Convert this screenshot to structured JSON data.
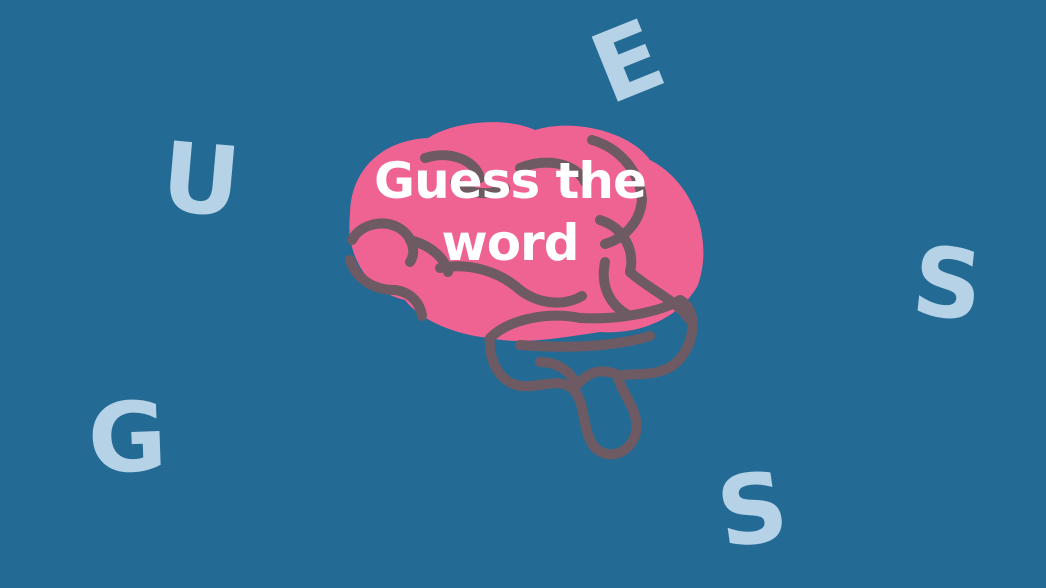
{
  "scene": {
    "title_line1": "Guess the",
    "title_line2": "word",
    "letters": [
      "G",
      "U",
      "E",
      "S",
      "S"
    ]
  },
  "colors": {
    "background": "#236b94",
    "letters": "#b5d2e6",
    "brain_fill": "#ef6392",
    "brain_outline": "#6e5a62",
    "title_text": "#ffffff"
  },
  "icons": [
    "brain-icon"
  ]
}
